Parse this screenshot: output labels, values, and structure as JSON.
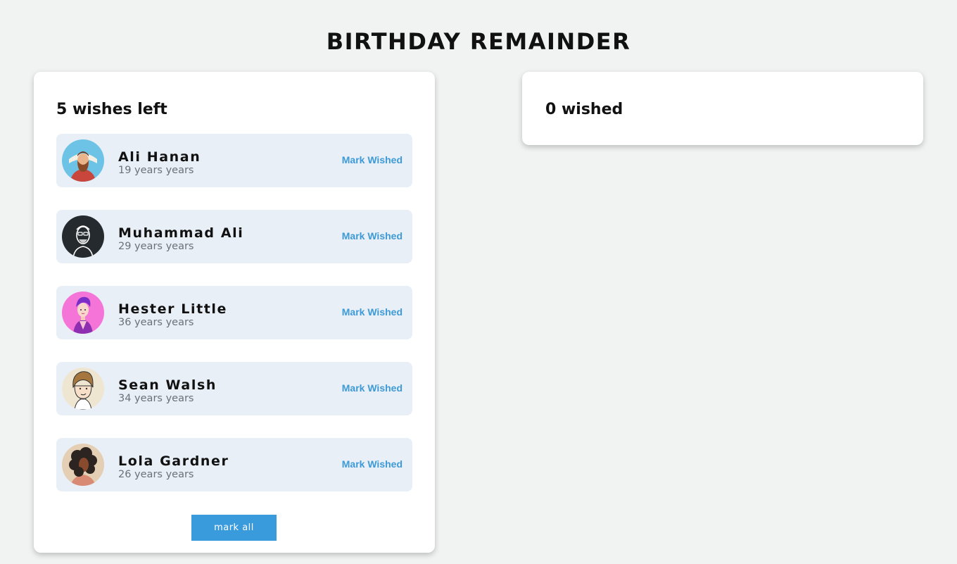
{
  "title": "BIRTHDAY REMAINDER",
  "pending": {
    "heading": "5 wishes left",
    "people": [
      {
        "name": "Ali Hanan",
        "age": "19 years years",
        "action": "Mark Wished",
        "avatar": "bearded-man-avatar-icon"
      },
      {
        "name": "Muhammad Ali",
        "age": "29 years years",
        "action": "Mark Wished",
        "avatar": "glasses-man-avatar-icon"
      },
      {
        "name": "Hester Little",
        "age": "36 years years",
        "action": "Mark Wished",
        "avatar": "purple-hair-avatar-icon"
      },
      {
        "name": "Sean Walsh",
        "age": "34 years years",
        "action": "Mark Wished",
        "avatar": "cartoon-man-avatar-icon"
      },
      {
        "name": "Lola Gardner",
        "age": "26 years years",
        "action": "Mark Wished",
        "avatar": "curly-hair-woman-avatar-icon"
      }
    ],
    "mark_all_label": "mark all"
  },
  "wished": {
    "heading": "0 wished"
  },
  "colors": {
    "background": "#f1f2f2",
    "card": "#ffffff",
    "row": "#e9eff6",
    "accent": "#3a9bdc",
    "link": "#3d9ad6",
    "muted_text": "#6b7178"
  }
}
